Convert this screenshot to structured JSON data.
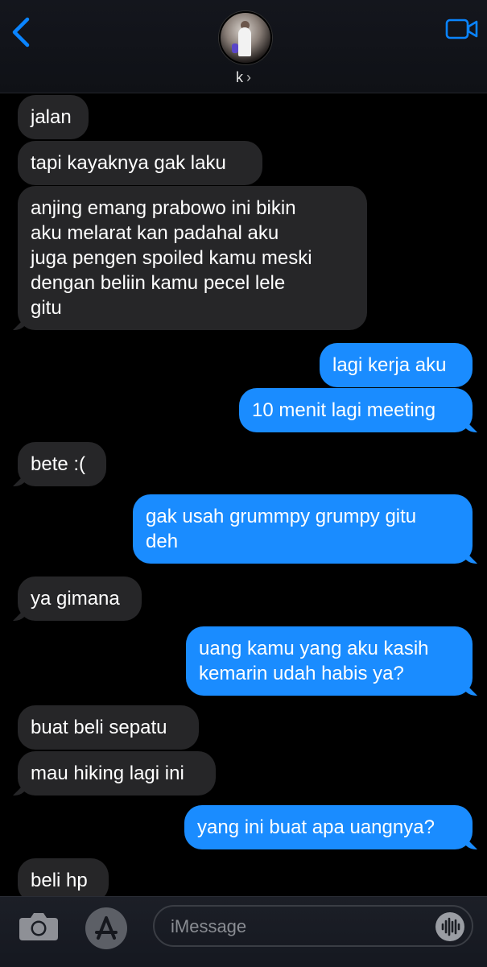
{
  "header": {
    "contact_name": "k",
    "contact_chevron": "›",
    "back_icon": "chevron-left-icon",
    "video_icon": "video-camera-icon",
    "accent_color": "#0a84ff"
  },
  "messages": [
    {
      "side": "in",
      "text": "jalan"
    },
    {
      "side": "in",
      "text": "tapi kayaknya gak laku"
    },
    {
      "side": "in",
      "text": "anjing emang prabowo ini bikin\naku melarat kan padahal aku\njuga pengen spoiled kamu meski\ndengan beliin kamu pecel lele\ngitu"
    },
    {
      "side": "out",
      "text": "lagi kerja aku"
    },
    {
      "side": "out",
      "text": "10 menit lagi meeting"
    },
    {
      "side": "in",
      "text": "bete :("
    },
    {
      "side": "out",
      "text": "gak usah grummpy grumpy gitu\ndeh"
    },
    {
      "side": "in",
      "text": "ya gimana"
    },
    {
      "side": "out",
      "text": "uang kamu yang aku kasih\nkemarin udah habis ya?"
    },
    {
      "side": "in",
      "text": "buat beli sepatu"
    },
    {
      "side": "in",
      "text": "mau hiking lagi ini"
    },
    {
      "side": "out",
      "text": "yang ini buat apa uangnya?"
    },
    {
      "side": "in",
      "text": "beli hp"
    }
  ],
  "composer": {
    "placeholder": "iMessage",
    "camera_icon": "camera-icon",
    "appstore_icon": "app-store-icon",
    "audio_icon": "waveform-icon"
  },
  "colors": {
    "incoming_bubble": "#262628",
    "outgoing_bubble": "#1a8cff",
    "background": "#000000"
  }
}
